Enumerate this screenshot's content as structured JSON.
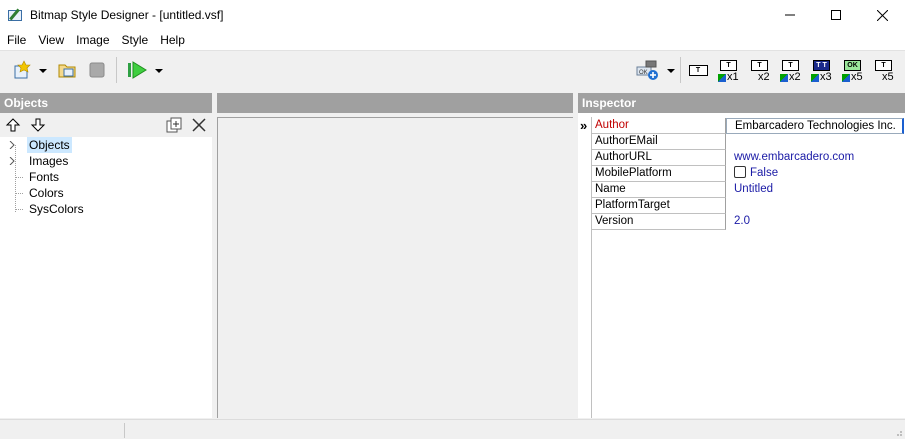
{
  "window": {
    "title": "Bitmap Style Designer - [untitled.vsf]",
    "minimize_glyph": "—",
    "maximize_glyph": "☐",
    "close_glyph": "✕"
  },
  "menu": [
    "File",
    "View",
    "Image",
    "Style",
    "Help"
  ],
  "toolbar": {
    "icons": [
      "new-icon",
      "open-icon",
      "save-icon",
      "run-icon",
      "add-object-icon"
    ],
    "format_buttons": [
      {
        "frame": "T",
        "sub": "x1",
        "colored": true
      },
      {
        "frame": "T",
        "sub": "x2",
        "colored": false
      },
      {
        "frame": "T",
        "sub": "x2",
        "colored": true
      },
      {
        "frame": "T T",
        "sub": "x3",
        "colored": true
      },
      {
        "frame": "OK",
        "sub": "x5",
        "colored": true
      },
      {
        "frame": "T",
        "sub": "x5",
        "colored": false
      }
    ],
    "small_frame": "T"
  },
  "objects_panel": {
    "title": "Objects",
    "tree": [
      {
        "label": "Objects",
        "expandable": true,
        "selected": true
      },
      {
        "label": "Images",
        "expandable": true,
        "selected": false
      },
      {
        "label": "Fonts",
        "expandable": false,
        "selected": false
      },
      {
        "label": "Colors",
        "expandable": false,
        "selected": false
      },
      {
        "label": "SysColors",
        "expandable": false,
        "selected": false
      }
    ]
  },
  "inspector": {
    "title": "Inspector",
    "rows": [
      {
        "name": "Author",
        "value": "Embarcadero Technologies Inc.",
        "active": true
      },
      {
        "name": "AuthorEMail",
        "value": "",
        "active": false
      },
      {
        "name": "AuthorURL",
        "value": "www.embarcadero.com",
        "active": false
      },
      {
        "name": "MobilePlatform",
        "value": "False",
        "checkbox": true,
        "active": false
      },
      {
        "name": "Name",
        "value": "Untitled",
        "active": false
      },
      {
        "name": "PlatformTarget",
        "value": "",
        "active": false
      },
      {
        "name": "Version",
        "value": "2.0",
        "active": false
      }
    ],
    "row_marker": "»"
  },
  "colors": {
    "header_gray": "#a0a0a0",
    "active_property": "#c00000",
    "value_blue": "#1a1aa6",
    "selection": "#cce8ff"
  }
}
